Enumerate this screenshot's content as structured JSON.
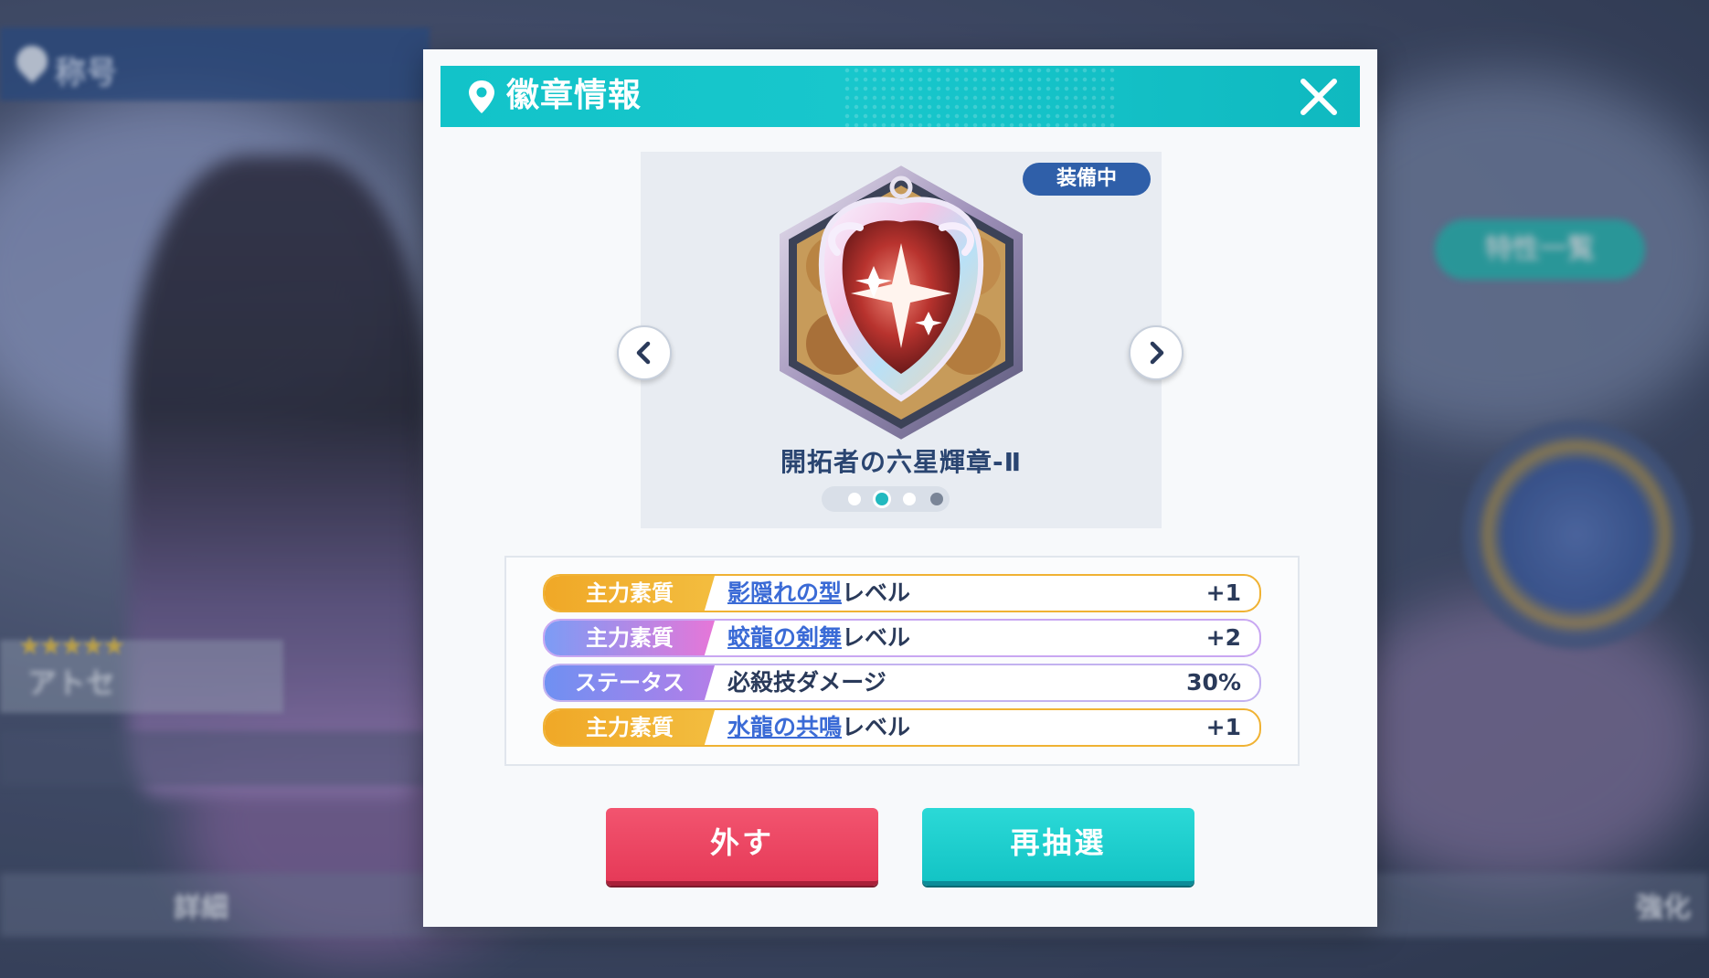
{
  "dialog": {
    "title": "徽章情報",
    "close_icon": "close-icon"
  },
  "badge": {
    "equipped_label": "装備中",
    "name": "開拓者の六星輝章-Ⅱ",
    "page_count": 4,
    "current_page": 2
  },
  "stats": [
    {
      "tag": "主力素質",
      "link": "影隠れの型",
      "suffix": "レベル",
      "value": "+1",
      "style": "orange"
    },
    {
      "tag": "主力素質",
      "link": "蛟龍の剣舞",
      "suffix": "レベル",
      "value": "+2",
      "style": "pink"
    },
    {
      "tag": "ステータス",
      "link": "",
      "suffix": "必殺技ダメージ",
      "value": "30%",
      "style": "blue"
    },
    {
      "tag": "主力素質",
      "link": "水龍の共鳴",
      "suffix": "レベル",
      "value": "+1",
      "style": "orange"
    }
  ],
  "buttons": {
    "remove": "外す",
    "redraw": "再抽選"
  },
  "colors": {
    "header": "#12c3c9",
    "remove_button": "#e63a58",
    "redraw_button": "#13c4c5",
    "equipped_badge": "#2f5fa9"
  }
}
